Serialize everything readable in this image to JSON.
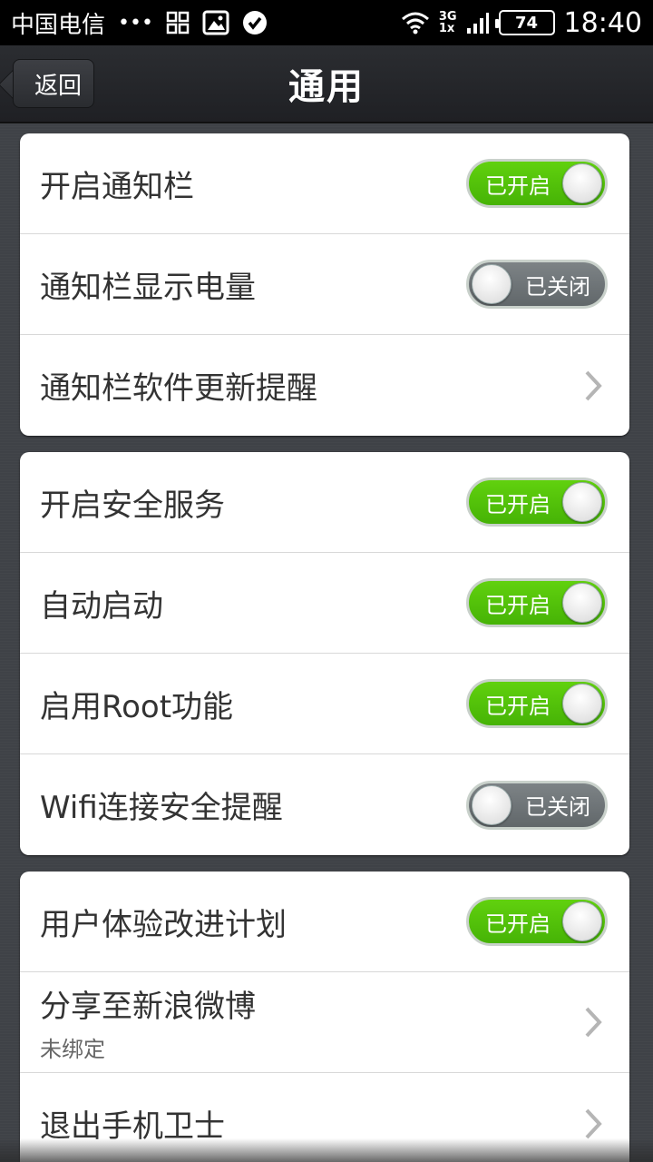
{
  "status_bar": {
    "carrier": "中国电信",
    "dots": "•••",
    "net_top": "3G",
    "net_bottom": "1x",
    "battery": "74",
    "time": "18:40"
  },
  "header": {
    "back_label": "返回",
    "title": "通用"
  },
  "groups": [
    {
      "rows": [
        {
          "label": "开启通知栏",
          "control": "toggle",
          "state": "on",
          "state_text": "已开启"
        },
        {
          "label": "通知栏显示电量",
          "control": "toggle",
          "state": "off",
          "state_text": "已关闭"
        },
        {
          "label": "通知栏软件更新提醒",
          "control": "chevron"
        }
      ]
    },
    {
      "rows": [
        {
          "label": "开启安全服务",
          "control": "toggle",
          "state": "on",
          "state_text": "已开启"
        },
        {
          "label": "自动启动",
          "control": "toggle",
          "state": "on",
          "state_text": "已开启"
        },
        {
          "label": "启用Root功能",
          "control": "toggle",
          "state": "on",
          "state_text": "已开启"
        },
        {
          "label": "Wifi连接安全提醒",
          "control": "toggle",
          "state": "off",
          "state_text": "已关闭"
        }
      ]
    },
    {
      "rows": [
        {
          "label": "用户体验改进计划",
          "control": "toggle",
          "state": "on",
          "state_text": "已开启"
        },
        {
          "label": "分享至新浪微博",
          "sublabel": "未绑定",
          "control": "chevron"
        },
        {
          "label": "退出手机卫士",
          "control": "chevron"
        }
      ]
    }
  ],
  "colors": {
    "toggle_on": "#52c20a",
    "toggle_off": "#6e7477",
    "background": "#3f4247"
  }
}
